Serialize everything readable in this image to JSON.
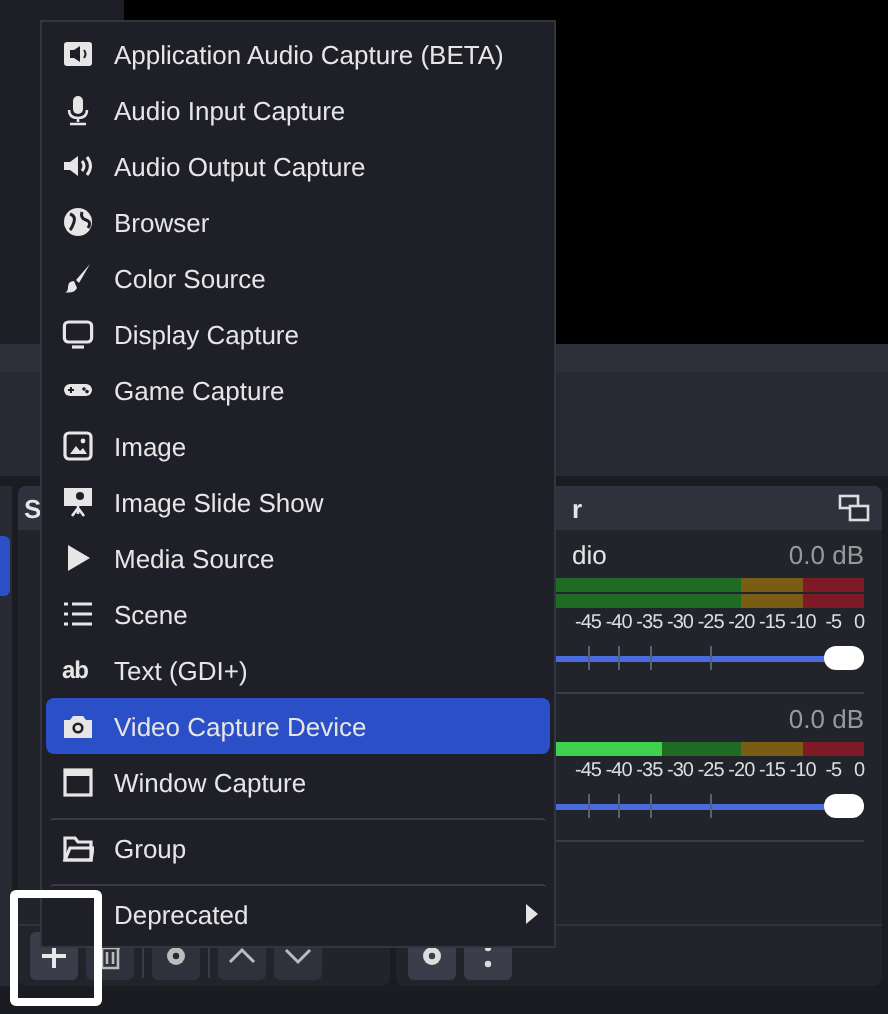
{
  "sources_panel": {
    "title": "S"
  },
  "add_menu": {
    "items": [
      {
        "label": "Application Audio Capture (BETA)",
        "selected": false,
        "separator_before": false,
        "submenu": false
      },
      {
        "label": "Audio Input Capture",
        "selected": false,
        "separator_before": false,
        "submenu": false
      },
      {
        "label": "Audio Output Capture",
        "selected": false,
        "separator_before": false,
        "submenu": false
      },
      {
        "label": "Browser",
        "selected": false,
        "separator_before": false,
        "submenu": false
      },
      {
        "label": "Color Source",
        "selected": false,
        "separator_before": false,
        "submenu": false
      },
      {
        "label": "Display Capture",
        "selected": false,
        "separator_before": false,
        "submenu": false
      },
      {
        "label": "Game Capture",
        "selected": false,
        "separator_before": false,
        "submenu": false
      },
      {
        "label": "Image",
        "selected": false,
        "separator_before": false,
        "submenu": false
      },
      {
        "label": "Image Slide Show",
        "selected": false,
        "separator_before": false,
        "submenu": false
      },
      {
        "label": "Media Source",
        "selected": false,
        "separator_before": false,
        "submenu": false
      },
      {
        "label": "Scene",
        "selected": false,
        "separator_before": false,
        "submenu": false
      },
      {
        "label": "Text (GDI+)",
        "icon_text": "ab",
        "selected": false,
        "separator_before": false,
        "submenu": false
      },
      {
        "label": "Video Capture Device",
        "selected": true,
        "separator_before": false,
        "submenu": false
      },
      {
        "label": "Window Capture",
        "selected": false,
        "separator_before": false,
        "submenu": false
      },
      {
        "label": "Group",
        "selected": false,
        "separator_before": true,
        "submenu": false
      },
      {
        "label": "Deprecated",
        "selected": false,
        "separator_before": true,
        "submenu": true
      }
    ]
  },
  "audio_mixer": {
    "title": "r",
    "channels": [
      {
        "name": "dio",
        "reading": "0.0 dB",
        "meters": [
          {
            "level": 0
          },
          {
            "level": 0
          }
        ],
        "scale": [
          "-45",
          "-40",
          "-35",
          "-30",
          "-25",
          "-20",
          "-15",
          "-10",
          "-5",
          "0"
        ],
        "volume": {
          "level": 1
        }
      },
      {
        "reading": "0.0 dB",
        "meters": [
          {
            "level": 0.45
          }
        ],
        "scale": [
          "-45",
          "-40",
          "-35",
          "-30",
          "-25",
          "-20",
          "-15",
          "-10",
          "-5",
          "0"
        ],
        "volume": {
          "level": 1
        }
      }
    ]
  }
}
